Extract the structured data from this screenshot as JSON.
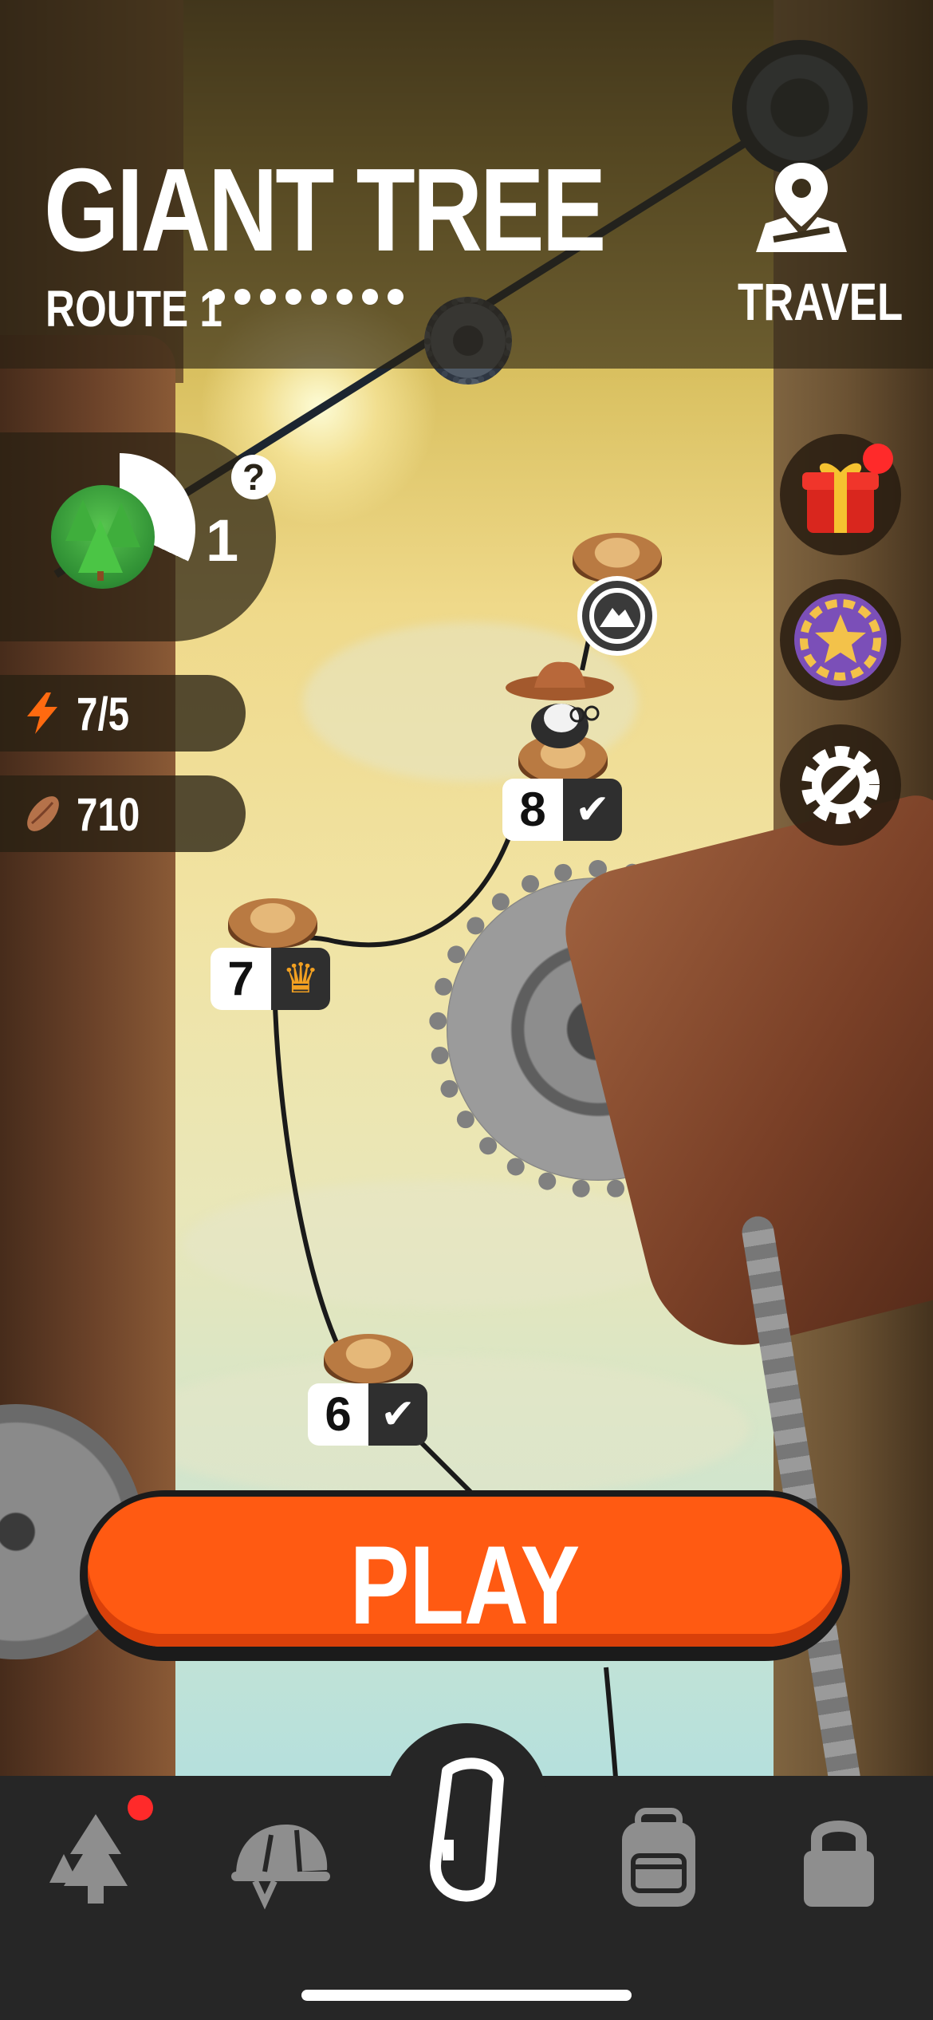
{
  "header": {
    "title": "GIANT TREE",
    "route": "ROUTE 1",
    "route_progress_dots": 8,
    "travel_label": "TRAVEL"
  },
  "player_level": {
    "value": "1",
    "help_symbol": "?"
  },
  "stats": {
    "energy": "7/5",
    "nuts": "710"
  },
  "side_buttons": [
    {
      "icon": "gift-icon",
      "has_notification": true
    },
    {
      "icon": "star-laurel-badge-icon",
      "has_notification": false
    },
    {
      "icon": "gear-wrench-settings-icon",
      "has_notification": false
    }
  ],
  "levels": [
    {
      "number": "8",
      "state": "✔",
      "status": "completed"
    },
    {
      "number": "7",
      "state": "♛",
      "status": "crown"
    },
    {
      "number": "6",
      "state": "✔",
      "status": "completed"
    }
  ],
  "play_button": {
    "label": "PLAY"
  },
  "tabbar": {
    "tabs": [
      {
        "icon": "tree-icon",
        "has_notification": true
      },
      {
        "icon": "helmet-icon",
        "has_notification": false
      },
      {
        "icon": "carabiner-icon",
        "selected": true
      },
      {
        "icon": "backpack-icon",
        "has_notification": false
      },
      {
        "icon": "lock-icon",
        "has_notification": false
      }
    ]
  },
  "colors": {
    "play_orange": "#ff5a12",
    "notification_red": "#ff2a2a",
    "crown_gold": "#f2a021",
    "tabbar_bg": "#262626"
  }
}
